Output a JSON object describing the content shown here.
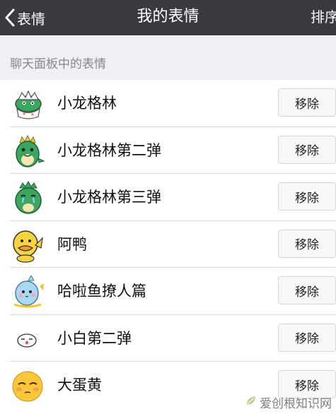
{
  "navbar": {
    "back_label": "表情",
    "title": "我的表情",
    "sort_label": "排序"
  },
  "section": {
    "header": "聊天面板中的表情"
  },
  "stickers": [
    {
      "name": "小龙格林",
      "icon": "green-dragon-eggshell-icon",
      "action": "移除"
    },
    {
      "name": "小龙格林第二弹",
      "icon": "green-dragon-icon",
      "action": "移除"
    },
    {
      "name": "小龙格林第三弹",
      "icon": "green-dragon-crying-icon",
      "action": "移除"
    },
    {
      "name": "阿鸭",
      "icon": "yellow-duck-icon",
      "action": "移除"
    },
    {
      "name": "哈啦鱼撩人篇",
      "icon": "blue-fish-icon",
      "action": "移除"
    },
    {
      "name": "小白第二弹",
      "icon": "white-blob-icon",
      "action": "移除"
    },
    {
      "name": "大蛋黄",
      "icon": "egg-yolk-face-icon",
      "action": "移除"
    }
  ],
  "watermark": {
    "text": "爱创根知识网",
    "icon": "leaf-logo-icon"
  },
  "colors": {
    "navbar": "#393a3f",
    "background": "#efeff4",
    "dragon_green": "#3aa65f",
    "duck_yellow": "#f7d33f",
    "fish_blue": "#a9d8f2",
    "yolk_yellow": "#fcc63a"
  }
}
